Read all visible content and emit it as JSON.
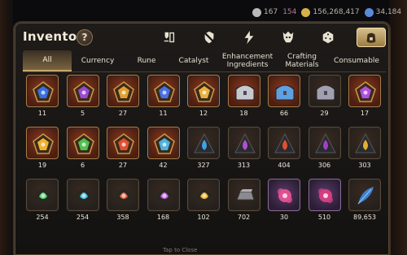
{
  "resources": [
    {
      "name": "silver",
      "value": "167",
      "color": "#b9b9b9"
    },
    {
      "name": "stamina",
      "value": "154",
      "color": "#c97aa0"
    },
    {
      "name": "gold",
      "value": "156,268,417",
      "color": "#d8b04a"
    },
    {
      "name": "skystone",
      "value": "34,184",
      "color": "#5a8ad8"
    }
  ],
  "inventory": {
    "title": "Inventory",
    "help_label": "?",
    "categories": [
      {
        "icon": "equipment-icon",
        "active": false
      },
      {
        "icon": "no-armor-icon",
        "active": false
      },
      {
        "icon": "lightning-icon",
        "active": false
      },
      {
        "icon": "monster-icon",
        "active": false
      },
      {
        "icon": "dice-icon",
        "active": false
      },
      {
        "icon": "material-bag-icon",
        "active": true
      }
    ],
    "tabs": [
      {
        "label": "All",
        "active": true
      },
      {
        "label": "Currency",
        "active": false
      },
      {
        "label": "Rune",
        "active": false
      },
      {
        "label": "Catalyst",
        "active": false
      },
      {
        "label": "Enhancement Ingredients",
        "active": false
      },
      {
        "label": "Crafting Materials",
        "active": false
      },
      {
        "label": "Consumable",
        "active": false
      }
    ],
    "items": [
      {
        "qty": "11",
        "icon": "blue-rune-icon",
        "color": "#3a6ee0",
        "rarity": "legend"
      },
      {
        "qty": "5",
        "icon": "purple-rune-icon",
        "color": "#9a4ad0",
        "rarity": "legend"
      },
      {
        "qty": "27",
        "icon": "gold-rune-icon",
        "color": "#e0a030",
        "rarity": "legend"
      },
      {
        "qty": "11",
        "icon": "blue-rune-icon",
        "color": "#4a70e8",
        "rarity": "legend"
      },
      {
        "qty": "12",
        "icon": "gold-rune-icon",
        "color": "#e8b040",
        "rarity": "legend"
      },
      {
        "qty": "18",
        "icon": "silver-chest-icon",
        "color": "#c8c8d0",
        "rarity": "legend"
      },
      {
        "qty": "66",
        "icon": "blue-chest-icon",
        "color": "#60a0e0",
        "rarity": "legend"
      },
      {
        "qty": "29",
        "icon": "dark-chest-icon",
        "color": "#a0a0b0",
        "rarity": "normal"
      },
      {
        "qty": "17",
        "icon": "purple-rune-icon",
        "color": "#b050e0",
        "rarity": "legend"
      },
      {
        "qty": "19",
        "icon": "gold-rune-icon",
        "color": "#f0b030",
        "rarity": "legend"
      },
      {
        "qty": "6",
        "icon": "green-rune-icon",
        "color": "#50c050",
        "rarity": "legend"
      },
      {
        "qty": "27",
        "icon": "red-rune-icon",
        "color": "#e05030",
        "rarity": "legend"
      },
      {
        "qty": "42",
        "icon": "cyan-rune-icon",
        "color": "#50b0e0",
        "rarity": "legend"
      },
      {
        "qty": "327",
        "icon": "blue-shard-icon",
        "color": "#40a0e0",
        "rarity": "normal"
      },
      {
        "qty": "313",
        "icon": "purple-shard-icon",
        "color": "#b050d0",
        "rarity": "normal"
      },
      {
        "qty": "404",
        "icon": "red-shard-icon",
        "color": "#e05030",
        "rarity": "normal"
      },
      {
        "qty": "306",
        "icon": "purple-shard-icon",
        "color": "#a040c0",
        "rarity": "normal"
      },
      {
        "qty": "303",
        "icon": "gold-shard-icon",
        "color": "#e0b030",
        "rarity": "normal"
      },
      {
        "qty": "254",
        "icon": "green-orb-icon",
        "color": "#50d070",
        "rarity": "normal"
      },
      {
        "qty": "254",
        "icon": "cyan-orb-icon",
        "color": "#40c0e0",
        "rarity": "normal"
      },
      {
        "qty": "358",
        "icon": "red-orb-icon",
        "color": "#e06040",
        "rarity": "normal"
      },
      {
        "qty": "168",
        "icon": "purple-orb-icon",
        "color": "#c060e0",
        "rarity": "normal"
      },
      {
        "qty": "102",
        "icon": "gold-orb-icon",
        "color": "#e8b030",
        "rarity": "normal"
      },
      {
        "qty": "702",
        "icon": "iron-ingot-icon",
        "color": "#8a8a90",
        "rarity": "normal"
      },
      {
        "qty": "30",
        "icon": "pink-flower-icon",
        "color": "#e05090",
        "rarity": "epic"
      },
      {
        "qty": "510",
        "icon": "pink-flower-icon",
        "color": "#d04080",
        "rarity": "epic"
      },
      {
        "qty": "89,653",
        "icon": "blue-feather-icon",
        "color": "#3a80d0",
        "rarity": "normal"
      }
    ],
    "close_hint": "Tap to Close"
  }
}
